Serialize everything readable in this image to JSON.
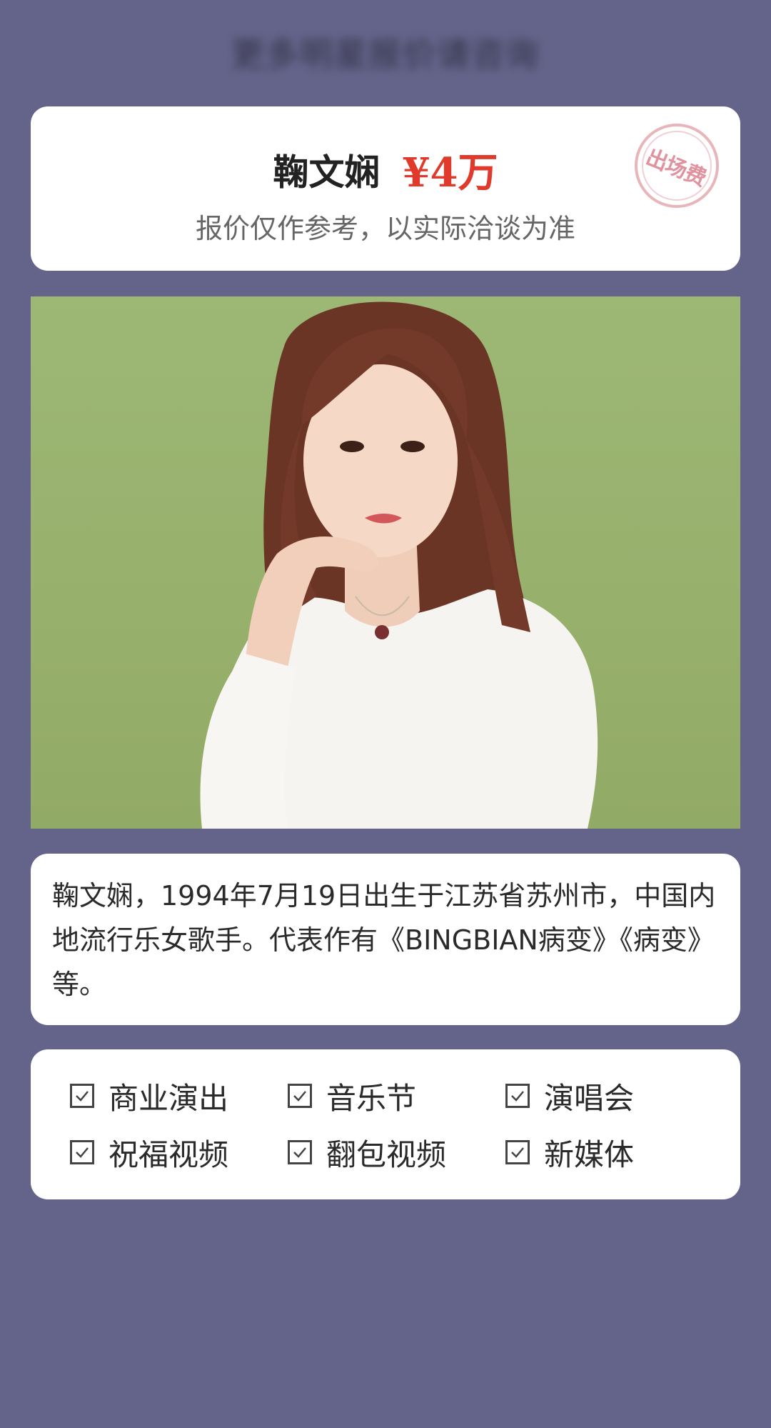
{
  "header": {
    "blurred_title": "更多明星报价请咨询"
  },
  "price_card": {
    "name": "鞠文娴",
    "fee": "¥4万",
    "note": "报价仅作参考，以实际洽谈为准",
    "stamp_label": "出场费"
  },
  "bio": {
    "text": "鞠文娴，1994年7月19日出生于江苏省苏州市，中国内地流行乐女歌手。代表作有《BINGBIAN病变》《病变》等。"
  },
  "services": [
    {
      "label": "商业演出",
      "checked": true
    },
    {
      "label": "音乐节",
      "checked": true
    },
    {
      "label": "演唱会",
      "checked": true
    },
    {
      "label": "祝福视频",
      "checked": true
    },
    {
      "label": "翻包视频",
      "checked": true
    },
    {
      "label": "新媒体",
      "checked": true
    }
  ],
  "colors": {
    "background": "#64648a",
    "price_accent": "#e03a2c",
    "photo_background": "#9db775"
  }
}
